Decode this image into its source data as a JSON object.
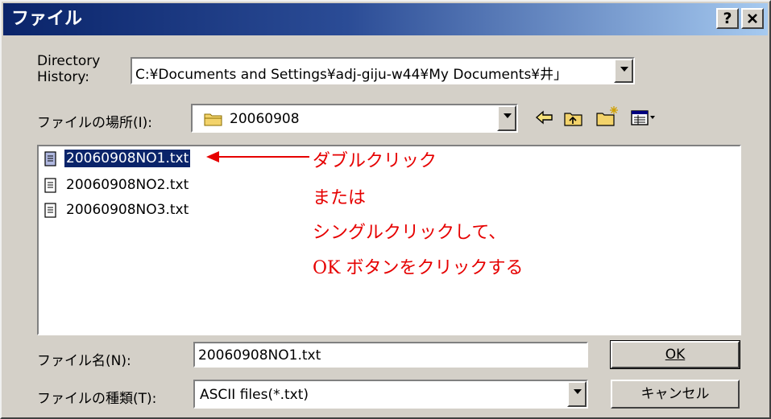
{
  "dialog": {
    "title": "ファイル",
    "help_label": "?",
    "close_label": "X"
  },
  "directory_history": {
    "label_line1": "Directory",
    "label_line2": "History:",
    "value": "C:¥Documents and Settings¥adj-giju-w44¥My Documents¥井」"
  },
  "location": {
    "label": "ファイルの場所(I):",
    "folder": "20060908"
  },
  "toolbar": {
    "icons": [
      "back-arrow-icon",
      "up-folder-icon",
      "new-folder-icon",
      "view-menu-icon"
    ]
  },
  "files": [
    {
      "name": "20060908NO1.txt",
      "selected": true
    },
    {
      "name": "20060908NO2.txt",
      "selected": false
    },
    {
      "name": "20060908NO3.txt",
      "selected": false
    }
  ],
  "annotation": {
    "lines": [
      "ダブルクリック",
      "または",
      "シングルクリックして、",
      "OK ボタンをクリックする"
    ],
    "color": "#e60000"
  },
  "filename": {
    "label": "ファイル名(N):",
    "value": "20060908NO1.txt"
  },
  "filetype": {
    "label": "ファイルの種類(T):",
    "value": "ASCII files(*.txt)"
  },
  "buttons": {
    "ok": "OK",
    "cancel": "キャンセル"
  },
  "colors": {
    "title_start": "#0a246a",
    "title_end": "#a6caf0",
    "selection": "#0a246a",
    "face": "#d4d0c8"
  }
}
